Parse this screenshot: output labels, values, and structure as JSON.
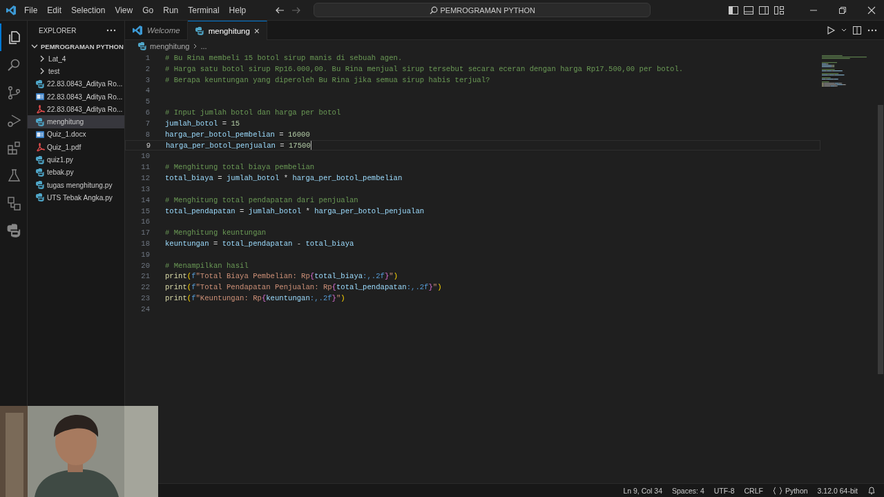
{
  "menu": [
    "File",
    "Edit",
    "Selection",
    "View",
    "Go",
    "Run",
    "Terminal",
    "Help"
  ],
  "search": {
    "value": "PEMROGRAMAN PYTHON"
  },
  "activity_bar": [
    {
      "kind": "explorer",
      "selected": true
    },
    {
      "kind": "search",
      "selected": false
    },
    {
      "kind": "source-control",
      "selected": false
    },
    {
      "kind": "run-debug",
      "selected": false
    },
    {
      "kind": "extensions",
      "selected": false
    },
    {
      "kind": "testing",
      "selected": false
    },
    {
      "kind": "remote",
      "selected": false
    },
    {
      "kind": "python",
      "selected": false
    }
  ],
  "sidebar": {
    "title": "EXPLORER",
    "folder": {
      "label": "PEMROGRAMAN PYTHON",
      "expanded": true
    },
    "items": [
      {
        "label": "Lat_4",
        "kind": "folder",
        "expanded": false,
        "selected": false
      },
      {
        "label": "test",
        "kind": "folder",
        "expanded": false,
        "selected": false
      },
      {
        "label": "22.83.0843_Aditya Ro...",
        "kind": "python",
        "selected": false
      },
      {
        "label": "22.83.0843_Aditya Ro...",
        "kind": "word",
        "selected": false
      },
      {
        "label": "22.83.0843_Aditya Ro...",
        "kind": "pdf",
        "selected": false
      },
      {
        "label": "menghitung",
        "kind": "python",
        "selected": true
      },
      {
        "label": "Quiz_1.docx",
        "kind": "word",
        "selected": false
      },
      {
        "label": "Quiz_1.pdf",
        "kind": "pdf",
        "selected": false
      },
      {
        "label": "quiz1.py",
        "kind": "python",
        "selected": false
      },
      {
        "label": "tebak.py",
        "kind": "python",
        "selected": false
      },
      {
        "label": "tugas menghitung.py",
        "kind": "python",
        "selected": false
      },
      {
        "label": "UTS Tebak Angka.py",
        "kind": "python",
        "selected": false
      }
    ]
  },
  "tabs": [
    {
      "label": "Welcome",
      "kind": "welcome",
      "selected": false
    },
    {
      "label": "menghitung",
      "kind": "python",
      "selected": true,
      "close": "×"
    }
  ],
  "breadcrumb": {
    "file": "menghitung",
    "rest": "..."
  },
  "code": [
    {
      "number": "1",
      "current": false,
      "tokens": [
        {
          "kind": "comment",
          "text": "# Bu Rina membeli 15 botol sirup manis di sebuah agen."
        }
      ]
    },
    {
      "number": "2",
      "current": false,
      "tokens": [
        {
          "kind": "comment",
          "text": "# Harga satu botol sirup Rp16.000,00. Bu Rina menjual sirup tersebut secara eceran dengan harga Rp17.500,00 per botol."
        }
      ]
    },
    {
      "number": "3",
      "current": false,
      "tokens": [
        {
          "kind": "comment",
          "text": "# Berapa keuntungan yang diperoleh Bu Rina jika semua sirup habis terjual?"
        }
      ]
    },
    {
      "number": "4",
      "current": false
    },
    {
      "number": "5",
      "current": false
    },
    {
      "number": "6",
      "current": false,
      "tokens": [
        {
          "kind": "comment",
          "text": "# Input jumlah botol dan harga per botol"
        }
      ]
    },
    {
      "number": "7",
      "current": false,
      "tokens": [
        {
          "kind": "var",
          "text": "jumlah_botol"
        },
        {
          "kind": "op",
          "text": " = "
        },
        {
          "kind": "num",
          "text": "15"
        }
      ]
    },
    {
      "number": "8",
      "current": false,
      "tokens": [
        {
          "kind": "var",
          "text": "harga_per_botol_pembelian"
        },
        {
          "kind": "op",
          "text": " = "
        },
        {
          "kind": "num",
          "text": "16000"
        }
      ]
    },
    {
      "number": "9",
      "current": true,
      "tokens": [
        {
          "kind": "var",
          "text": "harga_per_botol_penjualan"
        },
        {
          "kind": "op",
          "text": " = "
        },
        {
          "kind": "num",
          "text": "17500"
        }
      ]
    },
    {
      "number": "10",
      "current": false
    },
    {
      "number": "11",
      "current": false,
      "tokens": [
        {
          "kind": "comment",
          "text": "# Menghitung total biaya pembelian"
        }
      ]
    },
    {
      "number": "12",
      "current": false,
      "tokens": [
        {
          "kind": "var",
          "text": "total_biaya"
        },
        {
          "kind": "op",
          "text": " = "
        },
        {
          "kind": "var",
          "text": "jumlah_botol"
        },
        {
          "kind": "op",
          "text": " * "
        },
        {
          "kind": "var",
          "text": "harga_per_botol_pembelian"
        }
      ]
    },
    {
      "number": "13",
      "current": false
    },
    {
      "number": "14",
      "current": false,
      "tokens": [
        {
          "kind": "comment",
          "text": "# Menghitung total pendapatan dari penjualan"
        }
      ]
    },
    {
      "number": "15",
      "current": false,
      "tokens": [
        {
          "kind": "var",
          "text": "total_pendapatan"
        },
        {
          "kind": "op",
          "text": " = "
        },
        {
          "kind": "var",
          "text": "jumlah_botol"
        },
        {
          "kind": "op",
          "text": " * "
        },
        {
          "kind": "var",
          "text": "harga_per_botol_penjualan"
        }
      ]
    },
    {
      "number": "16",
      "current": false
    },
    {
      "number": "17",
      "current": false,
      "tokens": [
        {
          "kind": "comment",
          "text": "# Menghitung keuntungan"
        }
      ]
    },
    {
      "number": "18",
      "current": false,
      "tokens": [
        {
          "kind": "var",
          "text": "keuntungan"
        },
        {
          "kind": "op",
          "text": " = "
        },
        {
          "kind": "var",
          "text": "total_pendapatan"
        },
        {
          "kind": "op",
          "text": " - "
        },
        {
          "kind": "var",
          "text": "total_biaya"
        }
      ]
    },
    {
      "number": "19",
      "current": false
    },
    {
      "number": "20",
      "current": false,
      "tokens": [
        {
          "kind": "comment",
          "text": "# Menampilkan hasil"
        }
      ]
    },
    {
      "number": "21",
      "current": false,
      "tokens": [
        {
          "kind": "func",
          "text": "print"
        },
        {
          "kind": "paren",
          "text": "("
        },
        {
          "kind": "keyword",
          "text": "f"
        },
        {
          "kind": "string",
          "text": "\"Total Biaya Pembelian: Rp"
        },
        {
          "kind": "brace",
          "text": "{"
        },
        {
          "kind": "var",
          "text": "total_biaya"
        },
        {
          "kind": "keyword",
          "text": ":,.2f"
        },
        {
          "kind": "brace",
          "text": "}"
        },
        {
          "kind": "string",
          "text": "\""
        },
        {
          "kind": "paren",
          "text": ")"
        }
      ]
    },
    {
      "number": "22",
      "current": false,
      "tokens": [
        {
          "kind": "func",
          "text": "print"
        },
        {
          "kind": "paren",
          "text": "("
        },
        {
          "kind": "keyword",
          "text": "f"
        },
        {
          "kind": "string",
          "text": "\"Total Pendapatan Penjualan: Rp"
        },
        {
          "kind": "brace",
          "text": "{"
        },
        {
          "kind": "var",
          "text": "total_pendapatan"
        },
        {
          "kind": "keyword",
          "text": ":,.2f"
        },
        {
          "kind": "brace",
          "text": "}"
        },
        {
          "kind": "string",
          "text": "\""
        },
        {
          "kind": "paren",
          "text": ")"
        }
      ]
    },
    {
      "number": "23",
      "current": false,
      "tokens": [
        {
          "kind": "func",
          "text": "print"
        },
        {
          "kind": "paren",
          "text": "("
        },
        {
          "kind": "keyword",
          "text": "f"
        },
        {
          "kind": "string",
          "text": "\"Keuntungan: Rp"
        },
        {
          "kind": "brace",
          "text": "{"
        },
        {
          "kind": "var",
          "text": "keuntungan"
        },
        {
          "kind": "keyword",
          "text": ":,.2f"
        },
        {
          "kind": "brace",
          "text": "}"
        },
        {
          "kind": "string",
          "text": "\""
        },
        {
          "kind": "paren",
          "text": ")"
        }
      ]
    },
    {
      "number": "24",
      "current": false
    }
  ],
  "status_bar": {
    "items": [
      "Ln 9, Col 34",
      "Spaces: 4",
      "UTF-8",
      "CRLF"
    ],
    "language": "Python",
    "interpreter": "3.12.0 64-bit"
  }
}
